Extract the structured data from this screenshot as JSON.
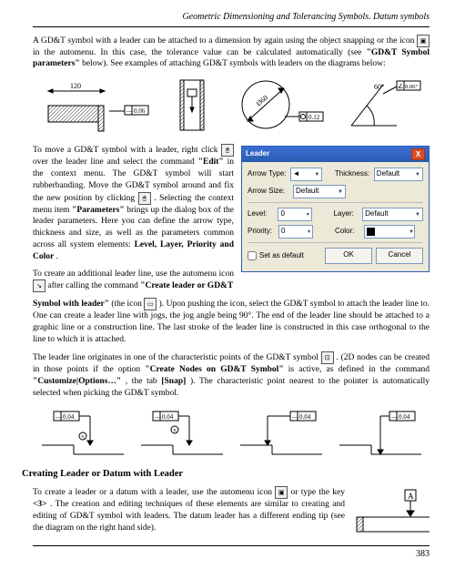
{
  "header": {
    "title": "Geometric Dimensioning and Tolerancing Symbols. Datum symbols"
  },
  "para1_a": "A GD&T symbol with a leader can be attached to a dimension by again using the object snapping or the icon ",
  "para1_b": " in the automenu. In this case, the tolerance value can be calculated automatically (see ",
  "para1_bold1": "\"GD&T Symbol parameters\"",
  "para1_c": " below). See examples of attaching GD&T symbols with leaders on the diagrams below:",
  "fig1": {
    "dim": "120",
    "tol1": "0.06",
    "tol2": "0.12",
    "angle": "Ø60",
    "tol3": "0.06°",
    "ang2": "60°"
  },
  "para2_a": "To move a GD&T symbol with a leader, right click ",
  "para2_b": " over the leader line and select the command ",
  "para2_bold1": "\"Edit\"",
  "para2_c": " in the context menu. The GD&T symbol will start rubberbanding. Move the GD&T symbol around and fix the new position by clicking ",
  "para2_d": ". Selecting the context menu item ",
  "para2_bold2": "\"Parameters\"",
  "para2_e": " brings up the dialog box of the leader parameters. Here you can define the arrow type, thickness and size, as well as the parameters common across all system elements: ",
  "para2_bold3": "Level, Layer, Priority and Color",
  "para2_f": ".",
  "para3_a": "To create an additional leader line, use the automenu icon ",
  "para3_b": " after calling the command ",
  "para3_bold1": "\"Create leader or GD&T",
  "dialog": {
    "title": "Leader",
    "arrow_type_lbl": "Arrow Type:",
    "thickness_lbl": "Thickness:",
    "thickness_val": "Default",
    "arrow_size_lbl": "Arrow Size:",
    "arrow_size_val": "Default",
    "level_lbl": "Level:",
    "level_val": "0",
    "layer_lbl": "Layer:",
    "layer_val": "Default",
    "priority_lbl": "Priority:",
    "priority_val": "0",
    "color_lbl": "Color:",
    "set_default": "Set as default",
    "ok": "OK",
    "cancel": "Cancel"
  },
  "para4_a": "Symbol with leader\"",
  "para4_b": " (the icon ",
  "para4_c": "). Upon pushing the icon, select the GD&T symbol to attach the leader line to. One can create a leader line with jogs, the jog angle being 90°. The end of the leader line should be attached to a graphic line or a construction line. The last stroke of the leader line is constructed in this case orthogonal to the line to which it is attached.",
  "para5_a": "The leader line originates in one of the characteristic points of the GD&T symbol ",
  "para5_b": ". (2D nodes can be created in those points if the option ",
  "para5_bold1": "\"Create Nodes on GD&T Symbol\"",
  "para5_c": " is active, as defined in the command ",
  "para5_bold2": "\"Customize|Options…\"",
  "para5_d": ", the tab ",
  "para5_bold3": "[Snap]",
  "para5_e": "). The characteristic point nearest to the pointer is automatically selected when picking the GD&T symbol.",
  "fig2": {
    "tol": "0.04"
  },
  "section_heading": "Creating Leader or Datum with Leader",
  "para6_a": "To create a leader or a datum with a leader, use the automenu icon ",
  "para6_b": " or type the key ",
  "para6_bold1": "<3>",
  "para6_c": ". The creation and editing techniques of these elements are similar to creating and editing of GD&T symbol with leaders. The datum leader has a different ending tip (see the diagram on the right hand side).",
  "datum_letter": "A",
  "page_number": "383"
}
